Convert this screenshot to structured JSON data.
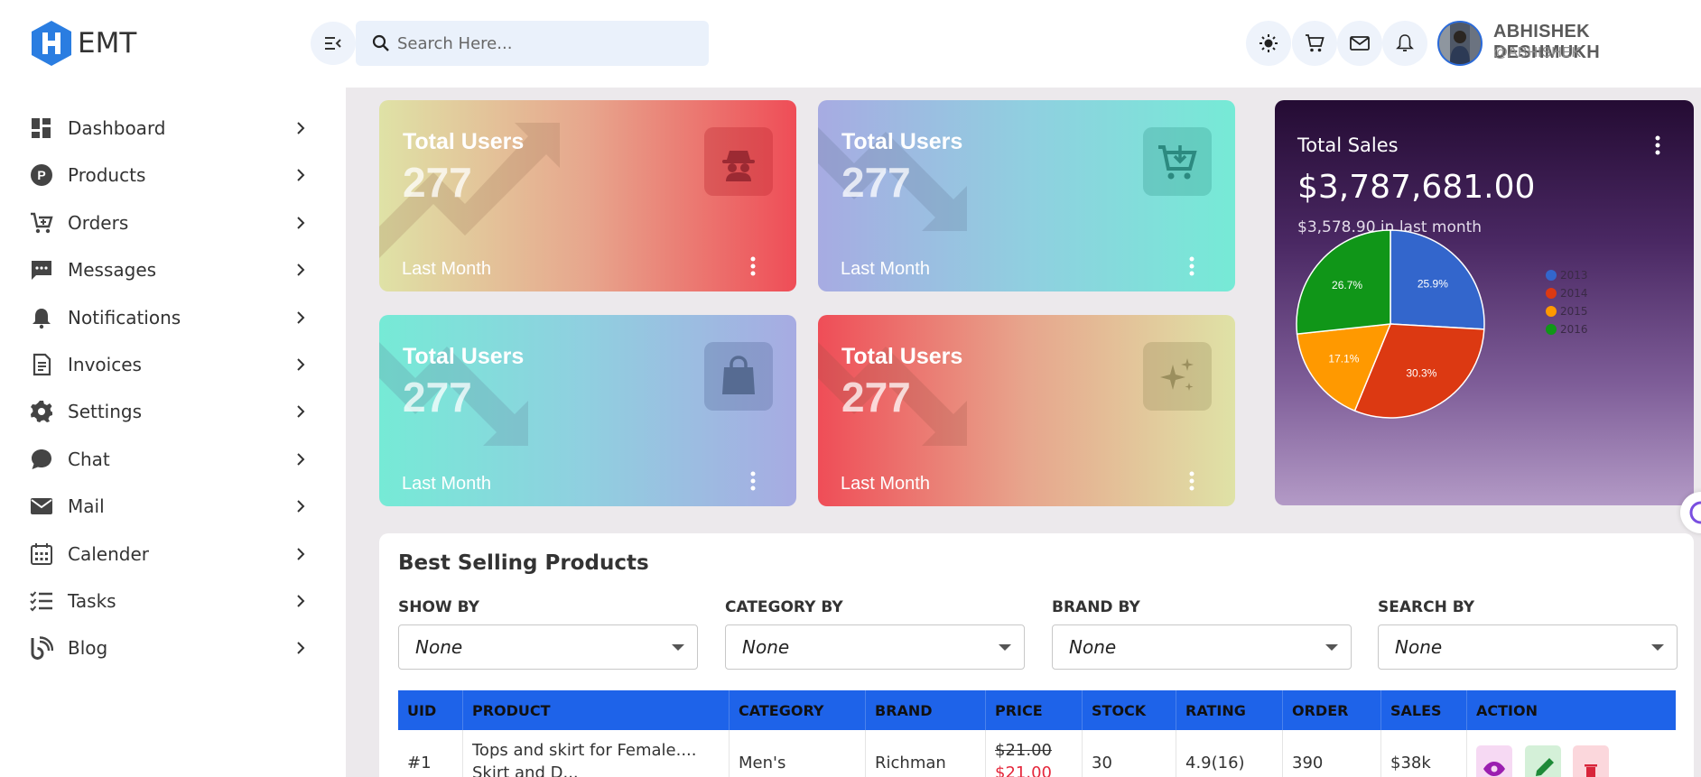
{
  "brand": {
    "name": "EMT"
  },
  "sidebar": {
    "items": [
      {
        "label": "Dashboard",
        "icon": "dashboard-icon"
      },
      {
        "label": "Products",
        "icon": "products-icon"
      },
      {
        "label": "Orders",
        "icon": "orders-cart-icon"
      },
      {
        "label": "Messages",
        "icon": "messages-icon"
      },
      {
        "label": "Notifications",
        "icon": "bell-icon"
      },
      {
        "label": "Invoices",
        "icon": "invoice-icon"
      },
      {
        "label": "Settings",
        "icon": "gear-icon"
      },
      {
        "label": "Chat",
        "icon": "chat-icon"
      },
      {
        "label": "Mail",
        "icon": "mail-icon"
      },
      {
        "label": "Calender",
        "icon": "calendar-icon"
      },
      {
        "label": "Tasks",
        "icon": "tasks-icon"
      },
      {
        "label": "Blog",
        "icon": "blog-icon"
      }
    ]
  },
  "header": {
    "search_placeholder": "Search Here...",
    "user_name": "ABHISHEK DESHMUKH",
    "user_handle": "@ABHISHEK"
  },
  "stats": [
    {
      "title": "Total Users",
      "value": "277",
      "footer": "Last Month",
      "icon": "spy-icon",
      "trend": "up"
    },
    {
      "title": "Total Users",
      "value": "277",
      "footer": "Last Month",
      "icon": "cart-download-icon",
      "trend": "down"
    },
    {
      "title": "Total Users",
      "value": "277",
      "footer": "Last Month",
      "icon": "shopping-bag-icon",
      "trend": "down"
    },
    {
      "title": "Total Users",
      "value": "277",
      "footer": "Last Month",
      "icon": "sparkles-icon",
      "trend": "down"
    }
  ],
  "sales": {
    "title": "Total Sales",
    "value": "$3,787,681.00",
    "subtitle": "$3,578.90 in last month"
  },
  "chart_data": {
    "type": "pie",
    "labels": [
      "2013",
      "2014",
      "2015",
      "2016"
    ],
    "values": [
      25.9,
      30.3,
      17.1,
      26.7
    ],
    "data_labels": [
      "25.9%",
      "30.3%",
      "17.1%",
      "26.7%"
    ],
    "colors": [
      "#3366cc",
      "#dc3912",
      "#ff9900",
      "#109618"
    ],
    "legend_position": "right"
  },
  "products": {
    "title": "Best Selling Products",
    "filters": [
      {
        "label": "SHOW BY",
        "value": "None"
      },
      {
        "label": "CATEGORY BY",
        "value": "None"
      },
      {
        "label": "BRAND BY",
        "value": "None"
      },
      {
        "label": "SEARCH BY",
        "value": "None"
      }
    ],
    "columns": [
      "UID",
      "PRODUCT",
      "CATEGORY",
      "BRAND",
      "PRICE",
      "STOCK",
      "RATING",
      "ORDER",
      "SALES",
      "ACTION"
    ],
    "rows": [
      {
        "uid": "#1",
        "product": "Tops and skirt for Female....",
        "product_line2": "Skirt and D...",
        "category": "Men's",
        "brand": "Richman",
        "price_old": "$21.00",
        "price_new": "$21.00",
        "stock": "30",
        "rating": "4.9(16)",
        "order": "390",
        "sales": "$38k"
      }
    ]
  }
}
